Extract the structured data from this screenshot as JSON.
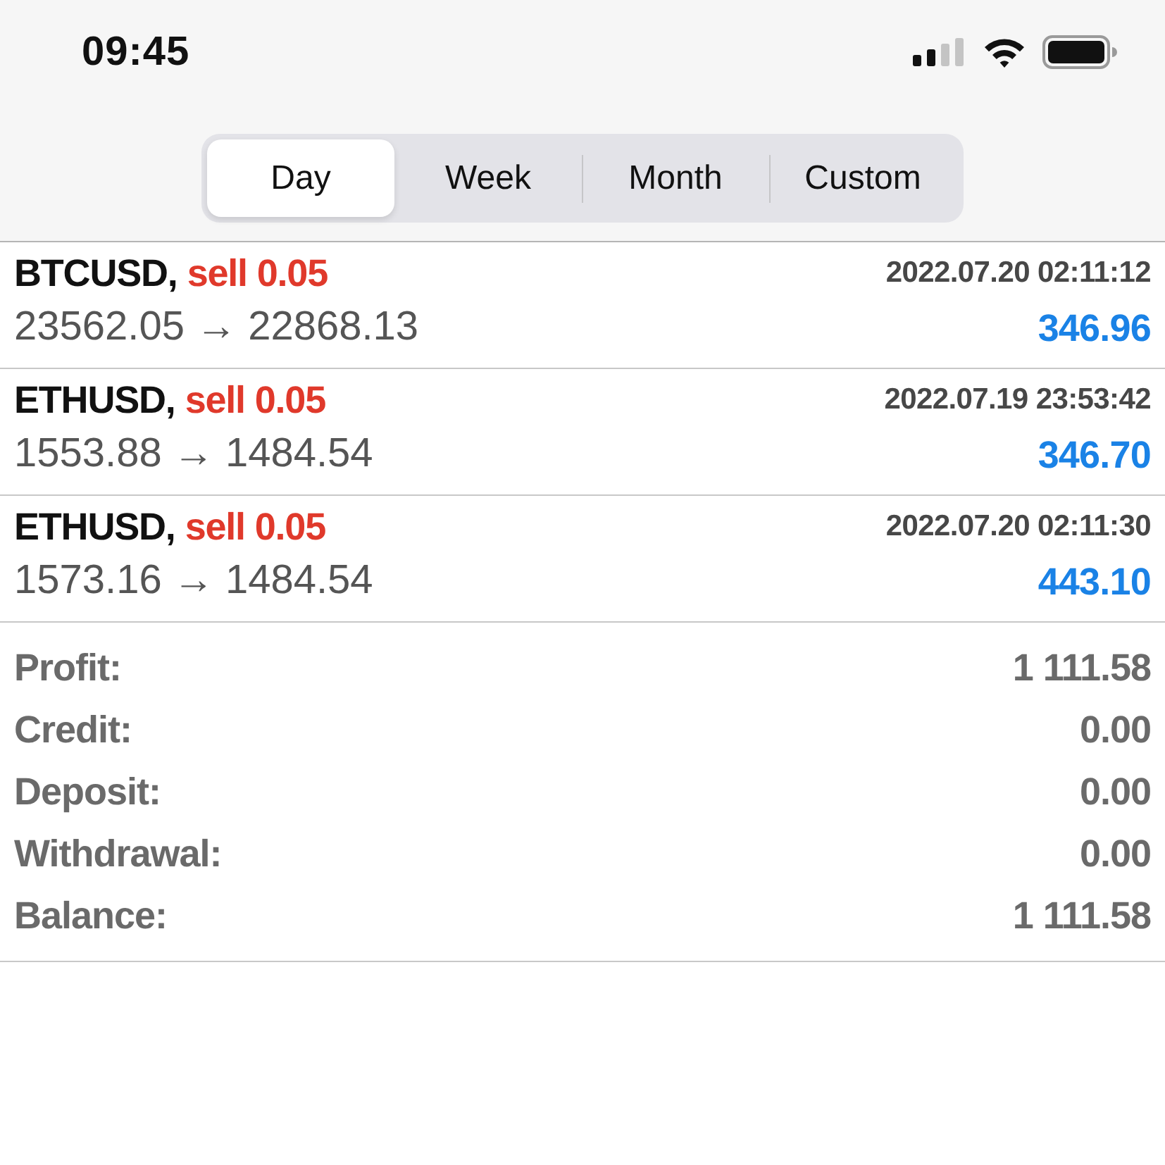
{
  "status_bar": {
    "time": "09:45"
  },
  "period_tabs": [
    {
      "label": "Day",
      "selected": true
    },
    {
      "label": "Week",
      "selected": false
    },
    {
      "label": "Month",
      "selected": false
    },
    {
      "label": "Custom",
      "selected": false
    }
  ],
  "deals": [
    {
      "symbol": "BTCUSD,",
      "side": "sell 0.05",
      "time": "2022.07.20 02:11:12",
      "prices": "23562.05 → 22868.13",
      "profit": "346.96"
    },
    {
      "symbol": "ETHUSD,",
      "side": "sell 0.05",
      "time": "2022.07.19 23:53:42",
      "prices": "1553.88 → 1484.54",
      "profit": "346.70"
    },
    {
      "symbol": "ETHUSD,",
      "side": "sell 0.05",
      "time": "2022.07.20 02:11:30",
      "prices": "1573.16 → 1484.54",
      "profit": "443.10"
    }
  ],
  "summary": [
    {
      "label": "Profit:",
      "value": "1 111.58"
    },
    {
      "label": "Credit:",
      "value": "0.00"
    },
    {
      "label": "Deposit:",
      "value": "0.00"
    },
    {
      "label": "Withdrawal:",
      "value": "0.00"
    },
    {
      "label": "Balance:",
      "value": "1 111.58"
    }
  ]
}
